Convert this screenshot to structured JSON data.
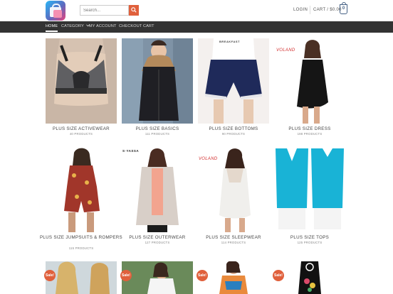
{
  "header": {
    "search_placeholder": "Search...",
    "login": "LOGIN",
    "cart_label": "CART / $0.00",
    "cart_count": "0"
  },
  "nav": [
    {
      "label": "HOME"
    },
    {
      "label": "CATEGORY"
    },
    {
      "label": "MY ACCOUNT"
    },
    {
      "label": "CHECKOUT"
    },
    {
      "label": "CART"
    }
  ],
  "categories": [
    {
      "title": "PLUS SIZE ACTIVEWEAR",
      "count": "40 PRODUCTS"
    },
    {
      "title": "PLUS SIZE BASICS",
      "count": "111 PRODUCTS"
    },
    {
      "title": "PLUS SIZE BOTTOMS",
      "count": "90 PRODUCTS"
    },
    {
      "title": "PLUS SIZE DRESS",
      "count": "198 PRODUCTS"
    },
    {
      "title": "PLUS SIZE JUMPSUITS & ROMPERS",
      "count": "115 PRODUCTS"
    },
    {
      "title": "PLUS SIZE OUTERWEAR",
      "count": "127 PRODUCTS"
    },
    {
      "title": "PLUS SIZE SLEEPWEAR",
      "count": "114 PRODUCTS"
    },
    {
      "title": "PLUS SIZE TOPS",
      "count": "125 PRODUCTS"
    }
  ],
  "brands": {
    "voland": "VOLAND",
    "s_yassa": "S·YASSA",
    "breakfast": "BREAKFAST"
  },
  "sale_badge": "Sale!",
  "colors": {
    "accent": "#e0603c",
    "nav_bg": "#333333",
    "cart_blue": "#446084"
  }
}
